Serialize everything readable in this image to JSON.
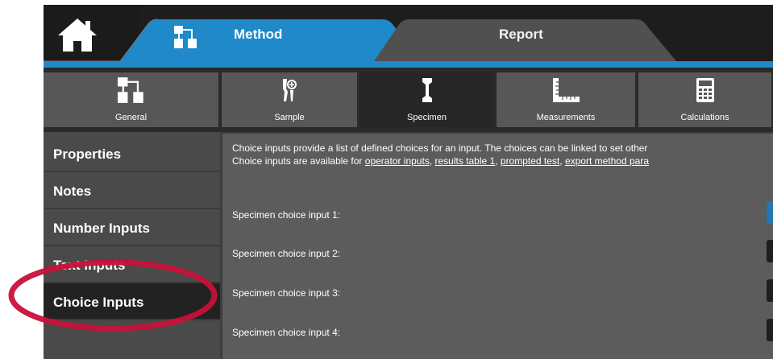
{
  "top_tabs": {
    "method_label": "Method",
    "report_label": "Report"
  },
  "icons": {
    "home": "home-icon",
    "method": "method-flowchart-icon"
  },
  "sub_tabs": [
    {
      "label": "General",
      "icon": "flowchart-icon",
      "active": false
    },
    {
      "label": "Sample",
      "icon": "sample-grip-icon",
      "active": false
    },
    {
      "label": "Specimen",
      "icon": "specimen-icon",
      "active": true
    },
    {
      "label": "Measurements",
      "icon": "ruler-corner-icon",
      "active": false
    },
    {
      "label": "Calculations",
      "icon": "calculator-icon",
      "active": false
    }
  ],
  "sidebar": {
    "items": [
      {
        "label": "Properties",
        "active": false
      },
      {
        "label": "Notes",
        "active": false
      },
      {
        "label": "Number Inputs",
        "active": false
      },
      {
        "label": "Text Inputs",
        "active": false
      },
      {
        "label": "Choice Inputs",
        "active": true
      }
    ]
  },
  "main": {
    "description_line1": "Choice inputs provide a list of defined choices for an input. The choices can be linked to set other",
    "description_line2_prefix": "Choice inputs are available for ",
    "links": [
      "operator inputs",
      "results table 1",
      "prompted test",
      "export method para"
    ],
    "separator": ", ",
    "choice_inputs": [
      {
        "label": "Specimen choice input  1:"
      },
      {
        "label": "Specimen choice input  2:"
      },
      {
        "label": "Specimen choice input  3:"
      },
      {
        "label": "Specimen choice input  4:"
      }
    ]
  },
  "colors": {
    "accent_blue": "#1f89c9",
    "highlight_ring": "#c8103a"
  }
}
